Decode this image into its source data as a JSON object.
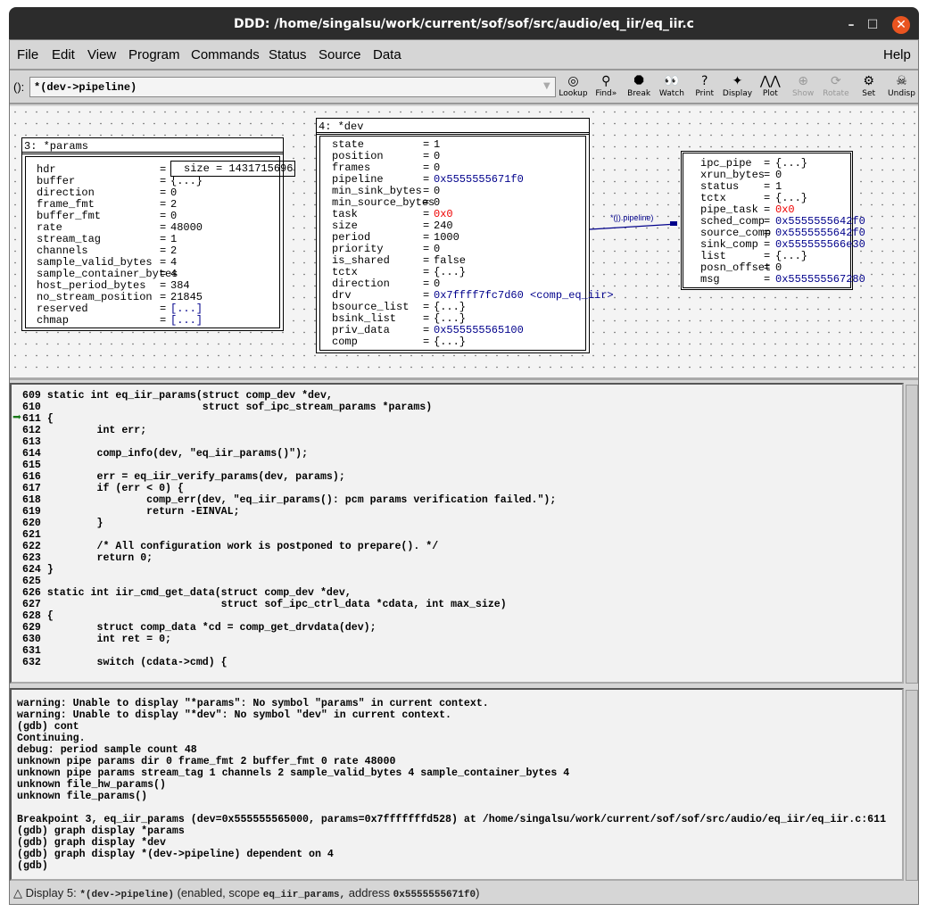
{
  "window": {
    "title": "DDD: /home/singalsu/work/current/sof/sof/src/audio/eq_iir/eq_iir.c",
    "controls": [
      "–",
      "☐",
      "✕"
    ]
  },
  "menubar": {
    "items": [
      "File",
      "Edit",
      "View",
      "Program",
      "Commands",
      "Status",
      "Source",
      "Data"
    ],
    "help": "Help"
  },
  "toolbar": {
    "arg_label": "():",
    "arg_value": "*(dev->pipeline)",
    "buttons": [
      {
        "label": "Lookup",
        "icon": "lookup-icon",
        "glyph": "◎",
        "enabled": true
      },
      {
        "label": "Find»",
        "icon": "binoculars-icon",
        "glyph": "⚲",
        "enabled": true
      },
      {
        "label": "Break",
        "icon": "stop-sign-icon",
        "glyph": "⯃",
        "enabled": true
      },
      {
        "label": "Watch",
        "icon": "eyes-icon",
        "glyph": "👀",
        "enabled": true
      },
      {
        "label": "Print",
        "icon": "question-icon",
        "glyph": "?",
        "enabled": true
      },
      {
        "label": "Display",
        "icon": "flashlight-icon",
        "glyph": "✦",
        "enabled": true
      },
      {
        "label": "Plot",
        "icon": "plot-icon",
        "glyph": "⋀⋀",
        "enabled": true
      },
      {
        "label": "Show",
        "icon": "magnifier-icon",
        "glyph": "⊕",
        "enabled": false
      },
      {
        "label": "Rotate",
        "icon": "rotate-icon",
        "glyph": "⟳",
        "enabled": false
      },
      {
        "label": "Set",
        "icon": "gear-icon",
        "glyph": "⚙",
        "enabled": true
      },
      {
        "label": "Undisp",
        "icon": "skull-icon",
        "glyph": "☠",
        "enabled": true
      }
    ]
  },
  "graph": {
    "params": {
      "title": "3: *params",
      "rows": [
        [
          "hdr",
          "size = 1431715696",
          "box"
        ],
        [
          "buffer",
          "{...}",
          ""
        ],
        [
          "direction",
          "0",
          ""
        ],
        [
          "frame_fmt",
          "2",
          ""
        ],
        [
          "buffer_fmt",
          "0",
          ""
        ],
        [
          "rate",
          "48000",
          ""
        ],
        [
          "stream_tag",
          "1",
          ""
        ],
        [
          "channels",
          "2",
          ""
        ],
        [
          "sample_valid_bytes",
          "4",
          ""
        ],
        [
          "sample_container_bytes",
          "4",
          ""
        ],
        [
          "host_period_bytes",
          "384",
          ""
        ],
        [
          "no_stream_position",
          "21845",
          ""
        ],
        [
          "reserved",
          "[...]",
          "blue"
        ],
        [
          "chmap",
          "[...]",
          "blue"
        ]
      ]
    },
    "dev": {
      "title": "4: *dev",
      "rows": [
        [
          "state",
          "1",
          ""
        ],
        [
          "position",
          "0",
          ""
        ],
        [
          "frames",
          "0",
          ""
        ],
        [
          "pipeline",
          "0x5555555671f0",
          "blue"
        ],
        [
          "min_sink_bytes",
          "0",
          ""
        ],
        [
          "min_source_bytes",
          "0",
          ""
        ],
        [
          "task",
          "0x0",
          "red"
        ],
        [
          "size",
          "240",
          ""
        ],
        [
          "period",
          "1000",
          ""
        ],
        [
          "priority",
          "0",
          ""
        ],
        [
          "is_shared",
          "false",
          ""
        ],
        [
          "tctx",
          "{...}",
          ""
        ],
        [
          "direction",
          "0",
          ""
        ],
        [
          "drv",
          "0x7ffff7fc7d60 <comp_eq_iir>",
          "blue"
        ],
        [
          "bsource_list",
          "{...}",
          ""
        ],
        [
          "bsink_list",
          "{...}",
          ""
        ],
        [
          "priv_data",
          "0x555555565100",
          "blue"
        ],
        [
          "comp",
          "{...}",
          ""
        ]
      ]
    },
    "pipeline": {
      "rows": [
        [
          "ipc_pipe",
          "{...}",
          ""
        ],
        [
          "xrun_bytes",
          "0",
          ""
        ],
        [
          "status",
          "1",
          ""
        ],
        [
          "tctx",
          "{...}",
          ""
        ],
        [
          "pipe_task",
          "0x0",
          "red"
        ],
        [
          "sched_comp",
          "0x5555555642f0",
          "blue"
        ],
        [
          "source_comp",
          "0x5555555642f0",
          "blue"
        ],
        [
          "sink_comp",
          "0x555555566e30",
          "blue"
        ],
        [
          "list",
          "{...}",
          ""
        ],
        [
          "posn_offset",
          "0",
          ""
        ],
        [
          "msg",
          "0x555555567280",
          "blue"
        ]
      ]
    },
    "edge_label": "*(|).pipeline)"
  },
  "source": {
    "current_line": "611",
    "lines": [
      [
        "609",
        "static int eq_iir_params(struct comp_dev *dev,"
      ],
      [
        "610",
        "                         struct sof_ipc_stream_params *params)"
      ],
      [
        "611",
        "{"
      ],
      [
        "612",
        "        int err;"
      ],
      [
        "613",
        ""
      ],
      [
        "614",
        "        comp_info(dev, \"eq_iir_params()\");"
      ],
      [
        "615",
        ""
      ],
      [
        "616",
        "        err = eq_iir_verify_params(dev, params);"
      ],
      [
        "617",
        "        if (err < 0) {"
      ],
      [
        "618",
        "                comp_err(dev, \"eq_iir_params(): pcm params verification failed.\");"
      ],
      [
        "619",
        "                return -EINVAL;"
      ],
      [
        "620",
        "        }"
      ],
      [
        "621",
        ""
      ],
      [
        "622",
        "        /* All configuration work is postponed to prepare(). */"
      ],
      [
        "623",
        "        return 0;"
      ],
      [
        "624",
        "}"
      ],
      [
        "625",
        ""
      ],
      [
        "626",
        "static int iir_cmd_get_data(struct comp_dev *dev,"
      ],
      [
        "627",
        "                            struct sof_ipc_ctrl_data *cdata, int max_size)"
      ],
      [
        "628",
        "{"
      ],
      [
        "629",
        "        struct comp_data *cd = comp_get_drvdata(dev);"
      ],
      [
        "630",
        "        int ret = 0;"
      ],
      [
        "631",
        ""
      ],
      [
        "632",
        "        switch (cdata->cmd) {"
      ]
    ]
  },
  "console": {
    "lines": [
      "warning: Unable to display \"*params\": No symbol \"params\" in current context.",
      "warning: Unable to display \"*dev\": No symbol \"dev\" in current context.",
      "(gdb) cont",
      "Continuing.",
      "debug: period sample count 48",
      "unknown pipe params dir 0 frame_fmt 2 buffer_fmt 0 rate 48000",
      "unknown pipe params stream_tag 1 channels 2 sample_valid_bytes 4 sample_container_bytes 4",
      "unknown file_hw_params()",
      "unknown file_params()",
      "",
      "Breakpoint 3, eq_iir_params (dev=0x555555565000, params=0x7fffffffd528) at /home/singalsu/work/current/sof/sof/src/audio/eq_iir/eq_iir.c:611",
      "(gdb) graph display *params",
      "(gdb) graph display *dev",
      "(gdb) graph display *(dev->pipeline) dependent on 4",
      "(gdb) "
    ]
  },
  "status": {
    "prefix": "Display 5:",
    "expr": "*(dev->pipeline)",
    "mid": "(enabled, scope",
    "scope": "eq_iir_params,",
    "addr_label": "address",
    "addr": "0x5555555671f0",
    "suffix": ")"
  },
  "colors": {
    "pointer": "#00008b",
    "null": "#e00000",
    "exec_arrow": "#1a7a1a"
  }
}
